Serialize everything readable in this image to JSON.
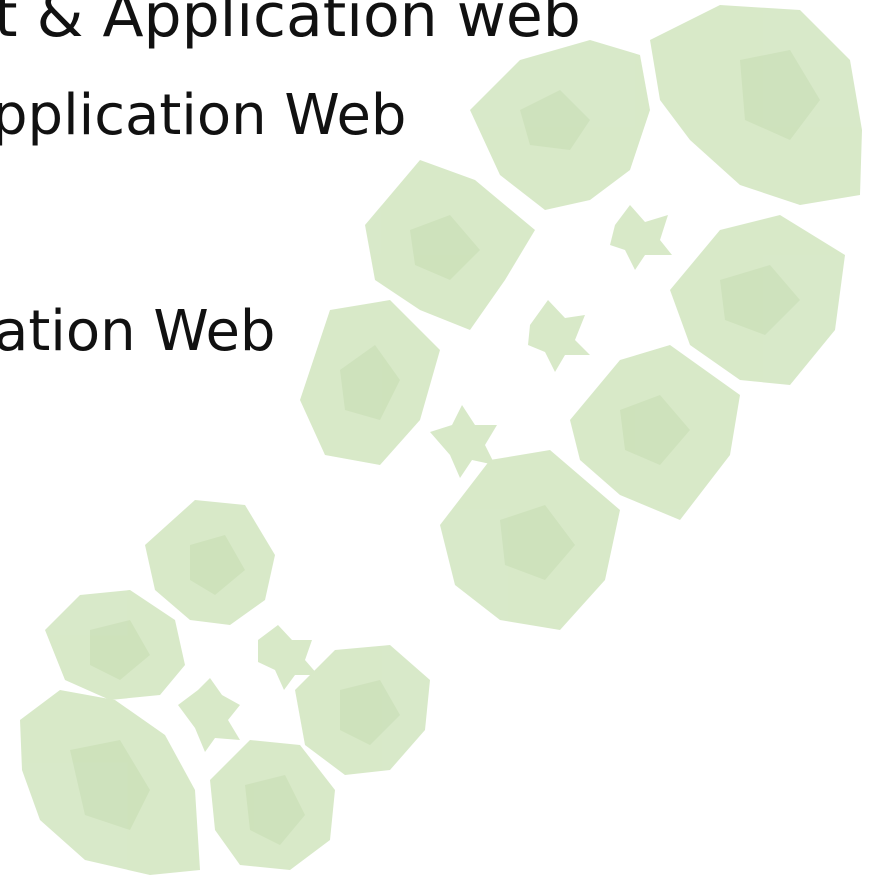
{
  "slide": {
    "lines": [
      "t & Application web",
      "pplication Web",
      "ation Web"
    ]
  },
  "colors": {
    "print_fill": "#d6e8c6",
    "print_shade": "#c6ddb2",
    "text": "#111111"
  },
  "icons": {
    "background_graphic": "bootprint-icon"
  }
}
